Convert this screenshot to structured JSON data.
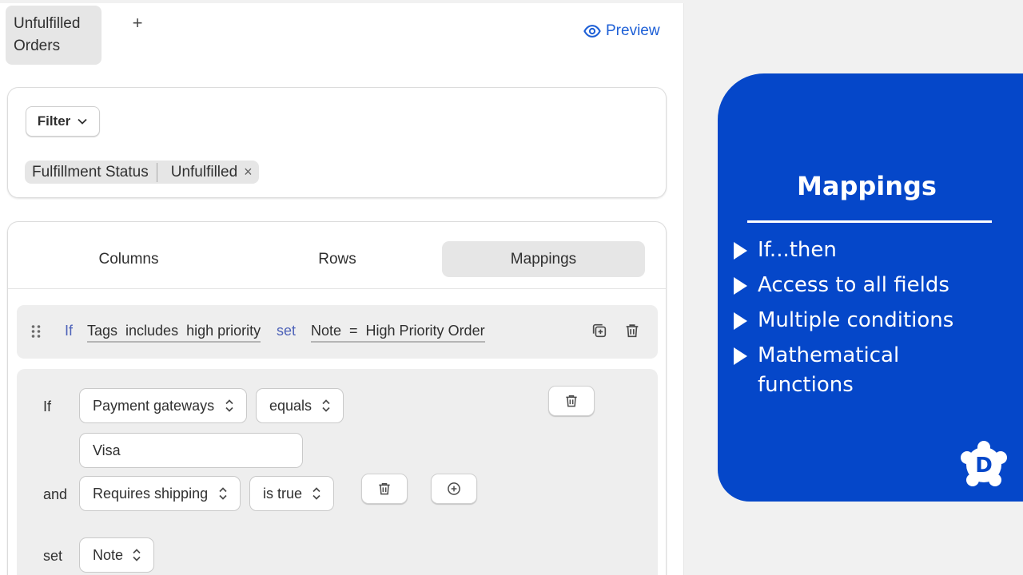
{
  "header": {
    "view_tab": "Unfulfilled Orders",
    "add_view": "+",
    "preview": "Preview"
  },
  "filter": {
    "button_label": "Filter",
    "chip_key": "Fulfillment Status",
    "chip_value": "Unfulfilled",
    "chip_remove": "×"
  },
  "tabs": [
    {
      "label": "Columns",
      "active": false
    },
    {
      "label": "Rows",
      "active": false
    },
    {
      "label": "Mappings",
      "active": true
    }
  ],
  "rule": {
    "if_kw": "If",
    "condition": "Tags  includes  high priority",
    "set_kw": "set",
    "assignment": "Note  =  High Priority Order"
  },
  "editor": {
    "if_label": "If",
    "field1": "Payment gateways",
    "operator1": "equals",
    "value1": "Visa",
    "and_label": "and",
    "field2": "Requires shipping",
    "operator2": "is true",
    "set_label": "set",
    "set_field": "Note"
  },
  "promo": {
    "title": "Mappings",
    "bullets": [
      "If...then",
      "Access to all fields",
      "Multiple conditions",
      "Mathematical functions"
    ],
    "logo_letter": "D",
    "colors": {
      "background": "#0547c9",
      "text": "#ffffff"
    }
  },
  "colors": {
    "link": "#1d5fd6",
    "keyword": "#4d62b8"
  }
}
